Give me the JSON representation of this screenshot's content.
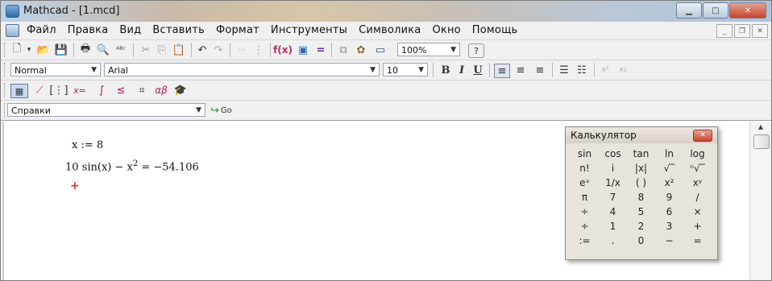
{
  "window": {
    "title": "Mathcad - [1.mcd]"
  },
  "menu": {
    "items": [
      "Файл",
      "Правка",
      "Вид",
      "Вставить",
      "Формат",
      "Инструменты",
      "Символика",
      "Окно",
      "Помощь"
    ]
  },
  "format_toolbar": {
    "style": "Normal",
    "font": "Arial",
    "size": "10",
    "bold": "B",
    "italic": "I",
    "underline": "U"
  },
  "standard_toolbar": {
    "zoom": "100%",
    "help": "?"
  },
  "resources_toolbar": {
    "selector": "Справки",
    "go": "Go"
  },
  "worksheet": {
    "definition": "x := 8",
    "expression_prefix": "10 sin(x) − x",
    "exponent": "2",
    "result": " = −54.106",
    "cursor": "+"
  },
  "calculator": {
    "title": "Калькулятор",
    "buttons": [
      "sin",
      "cos",
      "tan",
      "ln",
      "log",
      "n!",
      "i",
      "|x|",
      "√‾",
      "ⁿ√‾",
      "eˣ",
      "1/x",
      "( )",
      "x²",
      "xʸ",
      "π",
      "7",
      "8",
      "9",
      "/",
      "÷",
      "4",
      "5",
      "6",
      "×",
      "÷",
      "1",
      "2",
      "3",
      "+",
      ":=",
      ".",
      "0",
      "−",
      "="
    ]
  }
}
